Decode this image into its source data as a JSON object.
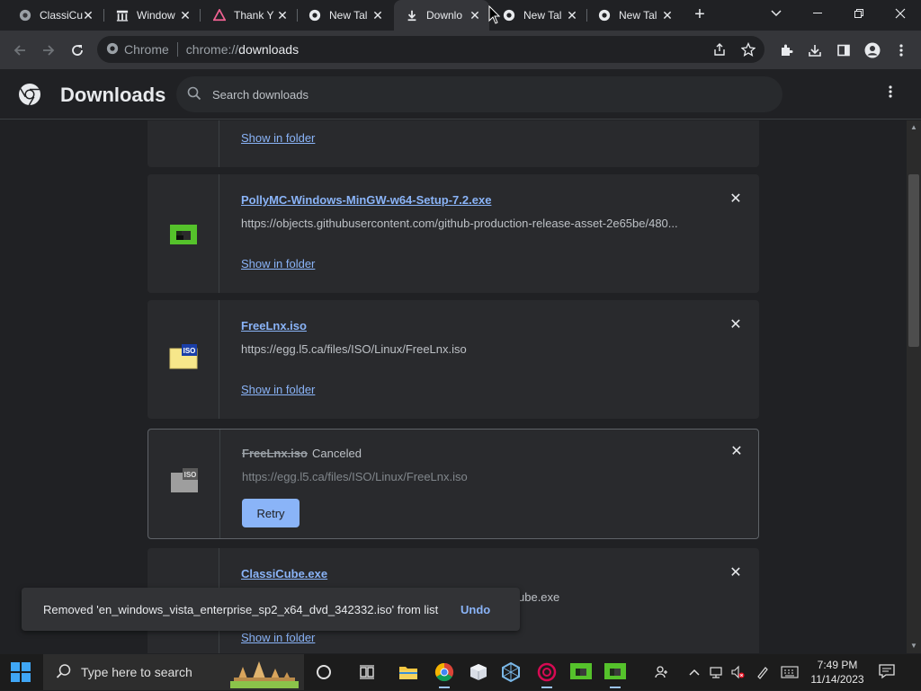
{
  "tabs": [
    {
      "label": "ClassiCu",
      "icon": "chrome-icon",
      "active": false
    },
    {
      "label": "Window",
      "icon": "archive-icon",
      "active": false
    },
    {
      "label": "Thank Y",
      "icon": "triangle-icon",
      "active": false
    },
    {
      "label": "New Tal",
      "icon": "chrome-icon",
      "active": false
    },
    {
      "label": "Downlo",
      "icon": "download-icon",
      "active": true
    },
    {
      "label": "New Tal",
      "icon": "chrome-icon",
      "active": false
    },
    {
      "label": "New Tal",
      "icon": "chrome-icon",
      "active": false
    }
  ],
  "toolbar": {
    "omnibox_chip": "Chrome",
    "url_scheme": "chrome://",
    "url_path": "downloads"
  },
  "header": {
    "title": "Downloads",
    "search_placeholder": "Search downloads"
  },
  "downloads": {
    "item0": {
      "show_in_folder": "Show in folder"
    },
    "item1": {
      "name": "PollyMC-Windows-MinGW-w64-Setup-7.2.exe",
      "url": "https://objects.githubusercontent.com/github-production-release-asset-2e65be/480...",
      "show_in_folder": "Show in folder"
    },
    "item2": {
      "name": "FreeLnx.iso",
      "url": "https://egg.l5.ca/files/ISO/Linux/FreeLnx.iso",
      "show_in_folder": "Show in folder"
    },
    "item3": {
      "name": "FreeLnx.iso",
      "status": "Canceled",
      "url": "https://egg.l5.ca/files/ISO/Linux/FreeLnx.iso",
      "retry": "Retry"
    },
    "item4": {
      "name": "ClassiCube.exe",
      "url_tail": "ube.exe",
      "show_in_folder": "Show in folder"
    }
  },
  "toast": {
    "message": "Removed 'en_windows_vista_enterprise_sp2_x64_dvd_342332.iso' from list",
    "undo": "Undo"
  },
  "taskbar": {
    "search_placeholder": "Type here to search",
    "time": "7:49 PM",
    "date": "11/14/2023"
  },
  "colors": {
    "accent": "#8ab4f8",
    "background": "#202124",
    "card": "#292a2d"
  }
}
